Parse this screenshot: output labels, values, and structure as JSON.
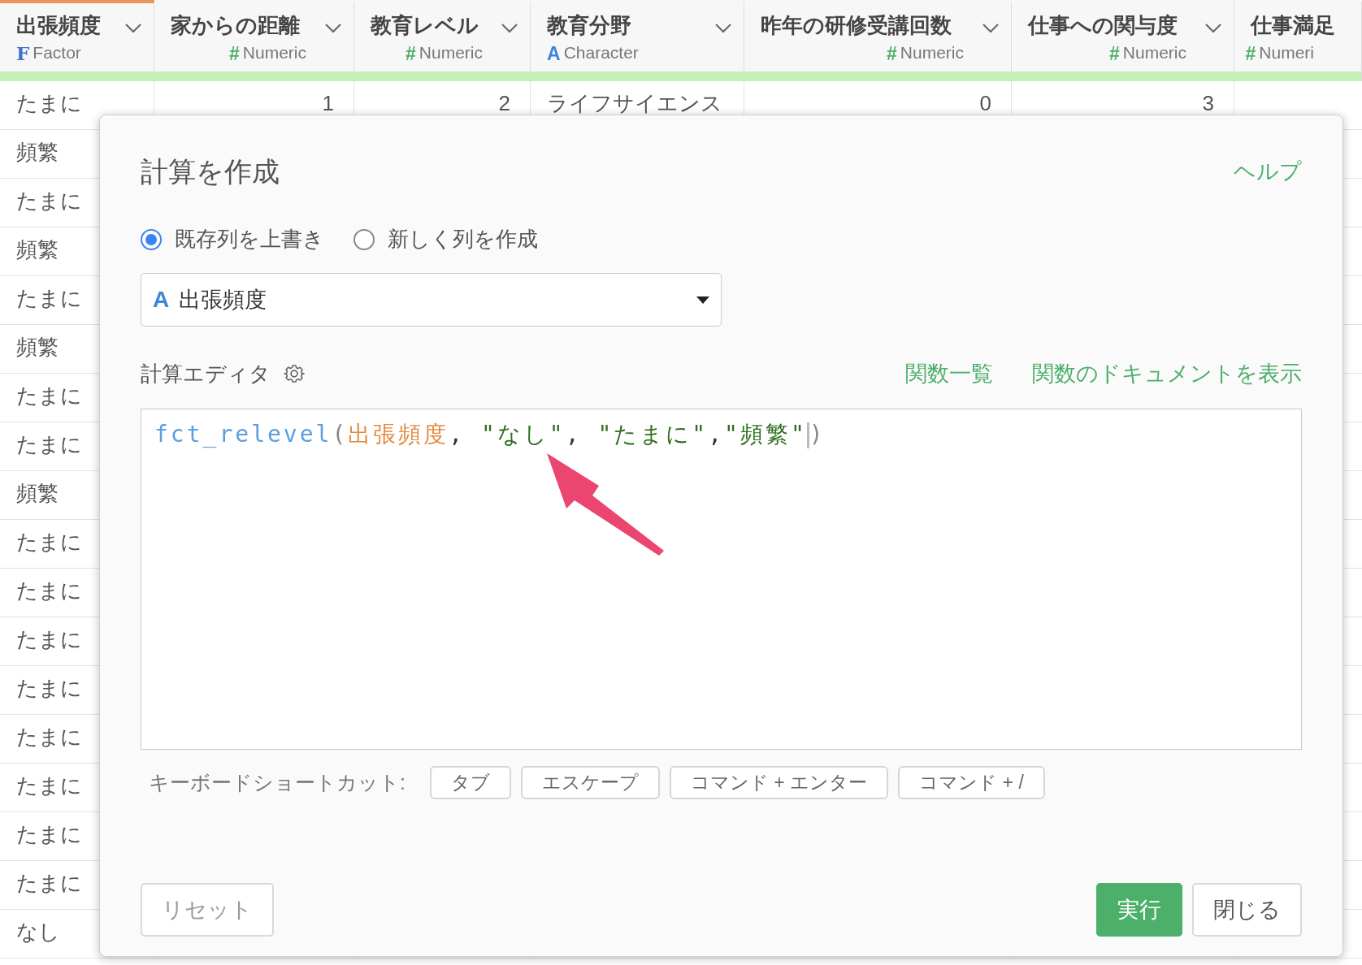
{
  "table": {
    "columns": [
      {
        "name": "出張頻度",
        "kind": "factor",
        "type_icon": "F",
        "type": "Factor",
        "selected": true
      },
      {
        "name": "家からの距離",
        "kind": "numeric",
        "type_icon": "#",
        "type": "Numeric",
        "selected": false
      },
      {
        "name": "教育レベル",
        "kind": "numeric",
        "type_icon": "#",
        "type": "Numeric",
        "selected": false
      },
      {
        "name": "教育分野",
        "kind": "character",
        "type_icon": "A",
        "type": "Character",
        "selected": false
      },
      {
        "name": "昨年の研修受講回数",
        "kind": "numeric",
        "type_icon": "#",
        "type": "Numeric",
        "selected": false
      },
      {
        "name": "仕事への関与度",
        "kind": "numeric",
        "type_icon": "#",
        "type": "Numeric",
        "selected": false
      },
      {
        "name": "仕事満足",
        "kind": "numeric",
        "type_icon": "#",
        "type": "Numeri",
        "selected": false,
        "menu": false
      }
    ],
    "rows": [
      {
        "cells": [
          "たまに",
          "1",
          "2",
          "ライフサイエンス",
          "0",
          "3"
        ]
      },
      {
        "cells": [
          "頻繁"
        ]
      },
      {
        "cells": [
          "たまに"
        ]
      },
      {
        "cells": [
          "頻繁"
        ]
      },
      {
        "cells": [
          "たまに"
        ]
      },
      {
        "cells": [
          "頻繁"
        ]
      },
      {
        "cells": [
          "たまに"
        ]
      },
      {
        "cells": [
          "たまに"
        ]
      },
      {
        "cells": [
          "頻繁"
        ]
      },
      {
        "cells": [
          "たまに"
        ]
      },
      {
        "cells": [
          "たまに"
        ]
      },
      {
        "cells": [
          "たまに"
        ]
      },
      {
        "cells": [
          "たまに"
        ]
      },
      {
        "cells": [
          "たまに"
        ]
      },
      {
        "cells": [
          "たまに"
        ]
      },
      {
        "cells": [
          "たまに"
        ]
      },
      {
        "cells": [
          "たまに"
        ]
      },
      {
        "cells": [
          "なし"
        ]
      }
    ]
  },
  "dialog": {
    "title": "計算を作成",
    "help_link": "ヘルプ",
    "modes": [
      {
        "label": "既存列を上書き",
        "selected": true
      },
      {
        "label": "新しく列を作成",
        "selected": false
      }
    ],
    "column_select": {
      "type_icon": "A",
      "value": "出張頻度"
    },
    "editor_label": "計算エディタ",
    "links": [
      "関数一覧",
      "関数のドキュメントを表示"
    ],
    "code": [
      {
        "kind": "function",
        "text": "fct_relevel"
      },
      {
        "kind": "paren",
        "text": "("
      },
      {
        "kind": "column",
        "text": "出張頻度"
      },
      {
        "kind": "punct",
        "text": ", "
      },
      {
        "kind": "string",
        "text": "\"なし\""
      },
      {
        "kind": "punct",
        "text": ", "
      },
      {
        "kind": "string",
        "text": "\"たまに\""
      },
      {
        "kind": "punct",
        "text": ","
      },
      {
        "kind": "string",
        "text": "\"頻繁\""
      },
      {
        "kind": "cursor"
      },
      {
        "kind": "paren",
        "text": ")"
      }
    ],
    "shortcuts_label": "キーボードショートカット:",
    "shortcuts": [
      "タブ",
      "エスケープ",
      "コマンド + エンター",
      "コマンド + /"
    ],
    "buttons": [
      {
        "label": "リセット",
        "kind": "reset"
      },
      {
        "label": "実行",
        "kind": "primary"
      },
      {
        "label": "閉じる",
        "kind": "close"
      }
    ]
  }
}
